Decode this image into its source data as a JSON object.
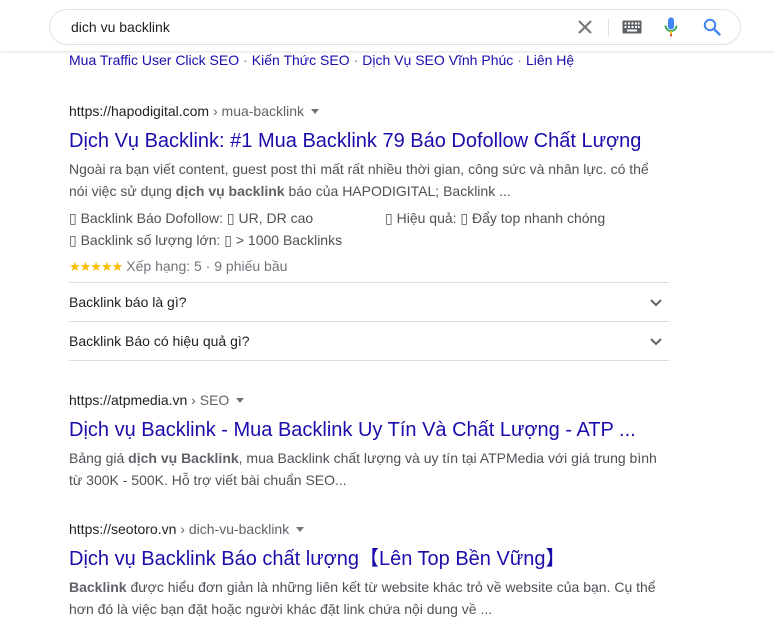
{
  "search": {
    "query": "dich vu backlink"
  },
  "sitelinks": [
    "Mua Traffic User Click SEO",
    "Kiến Thức SEO",
    "Dịch Vụ SEO Vĩnh Phúc",
    "Liên Hệ"
  ],
  "sitelink_sep": "·",
  "results": [
    {
      "domain": "https://hapodigital.com",
      "path": " › mua-backlink",
      "title": "Dịch Vụ Backlink: #1 Mua Backlink 79 Báo Dofollow Chất Lượng",
      "snippet_1": "Ngoài ra bạn viết content, guest post thì mất rất nhiều thời gian, công sức và nhân lực. có thể nói việc sử dụng ",
      "snippet_bold": "dịch vụ backlink",
      "snippet_2": " báo của HAPODIGITAL; Backlink ...",
      "attrs": [
        "▯ Backlink Báo Dofollow: ▯ UR, DR cao",
        "▯ Hiệu quả: ▯ Đẩy top nhanh chóng",
        "▯ Backlink số lượng lớn: ▯ > 1000 Backlinks"
      ],
      "stars": "★★★★★",
      "rating_text": "Xếp hạng: 5 · 9 phiếu bầu",
      "faqs": [
        "Backlink báo là gì?",
        "Backlink Báo có hiệu quả gì?"
      ]
    },
    {
      "domain": "https://atpmedia.vn",
      "path": " › SEO",
      "title": "Dịch vụ Backlink - Mua Backlink Uy Tín Và Chất Lượng - ATP ...",
      "snippet_1": "Bảng giá ",
      "snippet_bold": "dịch vụ Backlink",
      "snippet_2": ", mua Backlink chất lượng và uy tín tại ATPMedia với giá trung bình từ 300K - 500K. Hỗ trợ viết bài chuẩn SEO..."
    },
    {
      "domain": "https://seotoro.vn",
      "path": " › dich-vu-backlink",
      "title": "Dịch vụ Backlink Báo chất lượng【Lên Top Bền Vững】",
      "snippet_bold": "Backlink",
      "snippet_2": " được hiểu đơn giản là những liên kết từ website khác trỏ về website của bạn. Cụ thể hơn đó là việc bạn đặt hoặc người khác đặt link chứa nội dung về ..."
    }
  ],
  "colors": {
    "link": "#1a0dab",
    "star": "#fbbc04",
    "mic_blue": "#4285f4",
    "mic_red": "#ea4335"
  }
}
